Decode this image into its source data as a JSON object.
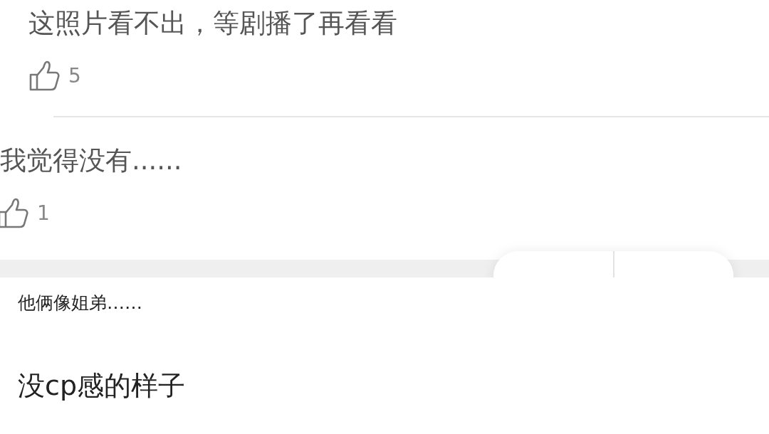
{
  "comments": [
    {
      "text": "这照片看不出，等剧播了再看看",
      "likes": "5",
      "kind": "indented"
    },
    {
      "text": "我觉得没有......",
      "likes": "1",
      "kind": "flush"
    }
  ],
  "posts": [
    {
      "text": "他俩像姐弟……",
      "kind": "small"
    },
    {
      "text": "没cp感的样子",
      "kind": "large"
    }
  ]
}
